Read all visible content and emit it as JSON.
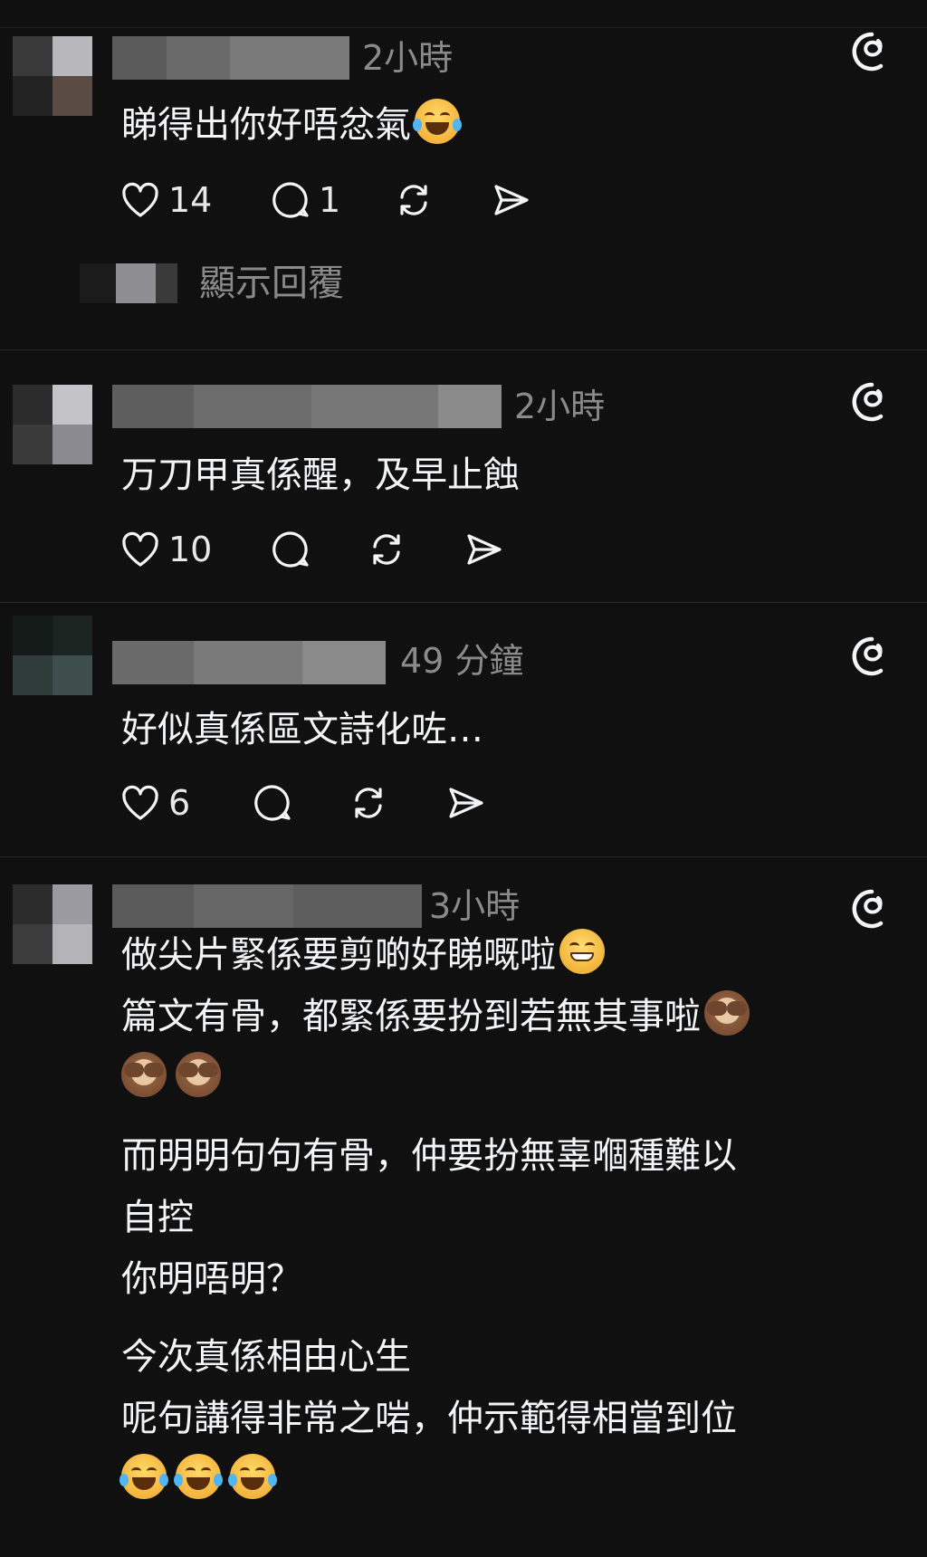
{
  "comments": [
    {
      "time": "2小時",
      "text_lines": [
        "睇得出你好唔忿氣"
      ],
      "trailing_emoji": "face-with-tears-of-joy",
      "likes": "14",
      "replies": "1",
      "show_replies_label": "顯示回覆"
    },
    {
      "time": "2小時",
      "text_lines": [
        "万刀甲真係醒，及早止蝕"
      ],
      "likes": "10"
    },
    {
      "time": "49 分鐘",
      "text_lines": [
        "好似真係區文詩化咗…"
      ],
      "likes": "6"
    },
    {
      "time": "3小時",
      "lines": {
        "l1": "做尖片緊係要剪啲好睇嘅啦",
        "l2": "篇文有骨，都緊係要扮到若無其事啦",
        "l3": "而明明句句有骨，仲要扮無辜嗰種難以",
        "l4": "自控",
        "l5": "你明唔明？",
        "l6": "今次真係相由心生",
        "l7": "呢句講得非常之啱，仲示範得相當到位"
      }
    }
  ],
  "colors": {
    "background": "#101010",
    "text": "#f3f5f7",
    "muted": "#8a8a8a",
    "divider": "#2a2a2a"
  },
  "icons": [
    "heart-icon",
    "comment-icon",
    "repost-icon",
    "share-icon",
    "threads-logo-icon"
  ]
}
